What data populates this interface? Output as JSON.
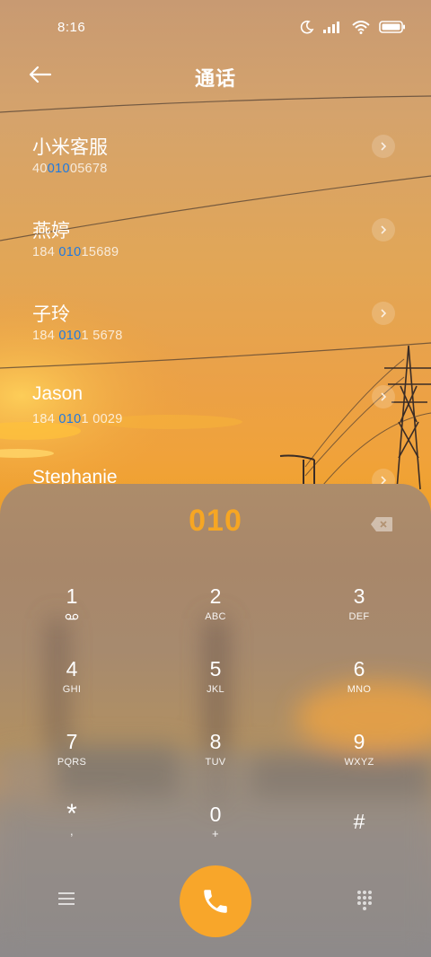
{
  "status_bar": {
    "time": "8:16"
  },
  "header": {
    "title": "通话"
  },
  "contacts": [
    {
      "name": "小米客服",
      "num_pre": "40",
      "num_hl": "010",
      "num_post": "05678"
    },
    {
      "name": "燕婷",
      "num_pre": "184 ",
      "num_hl": "010",
      "num_post": "15689"
    },
    {
      "name": "子玲",
      "num_pre": "184 ",
      "num_hl": "010",
      "num_post": "1 5678"
    },
    {
      "name": "Jason",
      "num_pre": "184 ",
      "num_hl": "010",
      "num_post": "1 0029"
    },
    {
      "name": "Stephanie",
      "num_pre": "",
      "num_hl": "",
      "num_post": ""
    }
  ],
  "dialer": {
    "input": "010",
    "keys": [
      {
        "digit": "1",
        "letters": ""
      },
      {
        "digit": "2",
        "letters": "ABC"
      },
      {
        "digit": "3",
        "letters": "DEF"
      },
      {
        "digit": "4",
        "letters": "GHI"
      },
      {
        "digit": "5",
        "letters": "JKL"
      },
      {
        "digit": "6",
        "letters": "MNO"
      },
      {
        "digit": "7",
        "letters": "PQRS"
      },
      {
        "digit": "8",
        "letters": "TUV"
      },
      {
        "digit": "9",
        "letters": "WXYZ"
      },
      {
        "digit": "*",
        "letters": ","
      },
      {
        "digit": "0",
        "letters": "+"
      },
      {
        "digit": "#",
        "letters": ""
      }
    ]
  },
  "colors": {
    "accent": "#f6a623",
    "highlight": "#1f7ae0",
    "call_button": "#f8a62a"
  },
  "icons": [
    "back-arrow-icon",
    "moon-icon",
    "signal-icon",
    "wifi-icon",
    "battery-icon",
    "chevron-right-icon",
    "backspace-icon",
    "voicemail-icon",
    "menu-icon",
    "phone-icon",
    "dialpad-icon"
  ]
}
